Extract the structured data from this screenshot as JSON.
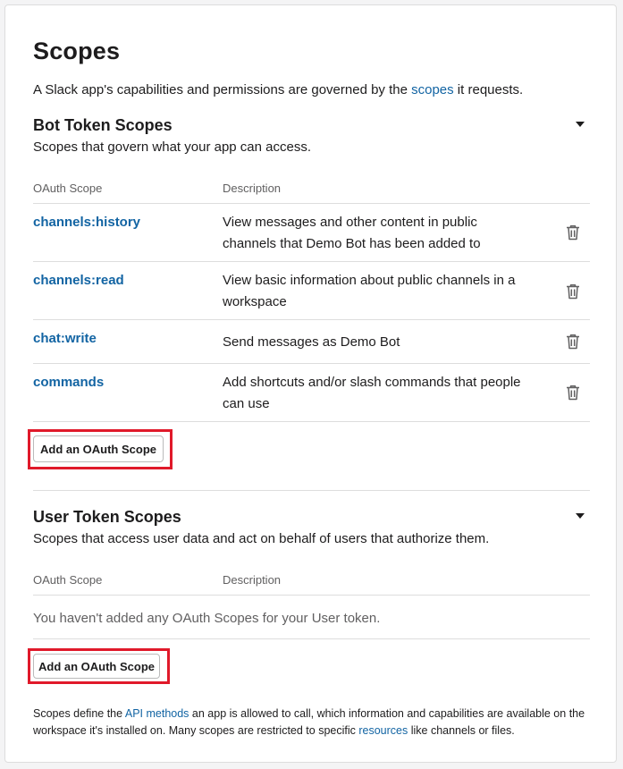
{
  "page": {
    "title": "Scopes",
    "intro_prefix": "A Slack app's capabilities and permissions are governed by the ",
    "intro_link": "scopes",
    "intro_suffix": " it requests."
  },
  "bot_section": {
    "title": "Bot Token Scopes",
    "subtitle": "Scopes that govern what your app can access.",
    "col_scope": "OAuth Scope",
    "col_desc": "Description",
    "rows": [
      {
        "name": "channels:history",
        "description": "View messages and other content in public channels that Demo Bot has been added to"
      },
      {
        "name": "channels:read",
        "description": "View basic information about public channels in a workspace"
      },
      {
        "name": "chat:write",
        "description": "Send messages as Demo Bot"
      },
      {
        "name": "commands",
        "description": "Add shortcuts and/or slash commands that people can use"
      }
    ],
    "add_button": "Add an OAuth Scope"
  },
  "user_section": {
    "title": "User Token Scopes",
    "subtitle": "Scopes that access user data and act on behalf of users that authorize them.",
    "col_scope": "OAuth Scope",
    "col_desc": "Description",
    "empty_text": "You haven't added any OAuth Scopes for your User token.",
    "add_button": "Add an OAuth Scope"
  },
  "footer": {
    "prefix": "Scopes define the ",
    "link1": "API methods",
    "middle": " an app is allowed to call, which information and capabilities are available on the workspace it's installed on. Many scopes are restricted to specific ",
    "link2": "resources",
    "suffix": " like channels or files."
  },
  "icons": {
    "row_delete": "trash-icon",
    "collapse": "caret-down-icon"
  },
  "colors": {
    "link": "#1264a3",
    "highlight": "#e0192a"
  }
}
